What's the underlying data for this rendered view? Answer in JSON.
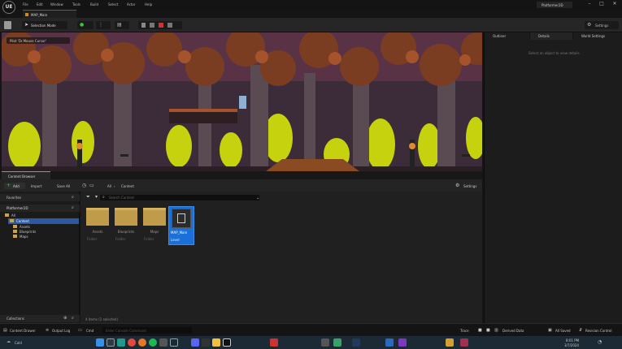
{
  "window": {
    "logo": "UE",
    "menu": [
      "File",
      "Edit",
      "Window",
      "Tools",
      "Build",
      "Select",
      "Actor",
      "Help"
    ],
    "level_tab": "MAP_Main",
    "project": "Platformer2D",
    "controls": [
      "–",
      "□",
      "✕"
    ]
  },
  "toolbar": {
    "selection_mode": "Selection Mode",
    "settings": "Settings"
  },
  "viewport": {
    "camera_hint": "Pilot 'Dr.Mouse Cursor'",
    "colors": {
      "sky": "#3c2c3a",
      "trunk": "#5a4b53",
      "leaf": "#7a3d22",
      "glow": "#c7d20f"
    }
  },
  "right": {
    "tabs": [
      "Outliner",
      "Details",
      "World Settings"
    ],
    "empty": "Select an object to view details."
  },
  "content_browser": {
    "tab": "Content Browser",
    "actions": {
      "add": "Add",
      "import": "Import",
      "save_all": "Save All",
      "settings": "Settings"
    },
    "path": [
      "All",
      "Content"
    ],
    "search_placeholder": "Search Content",
    "favorites": "Favorites",
    "project": "Platformer2D",
    "tree": [
      "All",
      "Content",
      "Assets",
      "Blueprints",
      "Maps"
    ],
    "assets": [
      {
        "name": "Assets",
        "kind": "folder",
        "type": "Folder"
      },
      {
        "name": "Blueprints",
        "kind": "folder",
        "type": "Folder"
      },
      {
        "name": "Maps",
        "kind": "folder",
        "type": "Folder"
      },
      {
        "name": "MAP_Main",
        "kind": "level",
        "type": "Level",
        "selected": true
      }
    ],
    "status": "4 items (1 selected)",
    "collections": "Collections"
  },
  "bottom": {
    "content_drawer": "Content Drawer",
    "output_log": "Output Log",
    "cmd": "Cmd",
    "console_placeholder": "Enter Console Command",
    "trace": "Trace",
    "derived_data": "Derived Data",
    "all_saved": "All Saved",
    "revision_control": "Revision Control"
  },
  "taskbar": {
    "weather": "Cold",
    "time": "8:01 PM",
    "date": "3/7/2024",
    "icons": [
      "windows-icon",
      "search-icon",
      "edge-icon",
      "chrome-icon",
      "firefox-icon",
      "spotify-icon",
      "git-icon",
      "steam-icon",
      "discord-icon",
      "terminal-icon",
      "folder-icon",
      "unreal-icon",
      "vscode-icon",
      "visual-studio-icon",
      "store-icon",
      "mail-icon",
      "photoshop-icon",
      "app-icon"
    ]
  }
}
